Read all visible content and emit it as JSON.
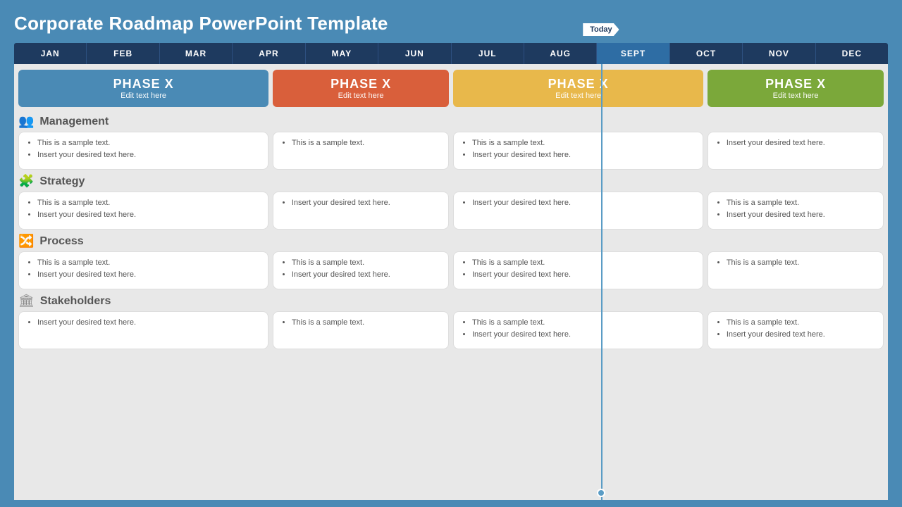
{
  "title": "Corporate Roadmap PowerPoint Template",
  "today_label": "Today",
  "months": [
    "JAN",
    "FEB",
    "MAR",
    "APR",
    "MAY",
    "JUN",
    "JUL",
    "AUG",
    "SEPT",
    "OCT",
    "NOV",
    "DEC"
  ],
  "today_month_index": 8,
  "phases": [
    {
      "label": "PHASE X",
      "subtitle": "Edit text here",
      "color": "blue"
    },
    {
      "label": "PHASE X",
      "subtitle": "Edit text here",
      "color": "orange"
    },
    {
      "label": "PHASE X",
      "subtitle": "Edit text here",
      "color": "yellow"
    },
    {
      "label": "PHASE X",
      "subtitle": "Edit text here",
      "color": "green"
    }
  ],
  "sections": [
    {
      "title": "Management",
      "icon": "👥",
      "cards": [
        {
          "items": [
            "This is a sample text.",
            "Insert your desired text here."
          ]
        },
        {
          "items": [
            "This is a sample text."
          ]
        },
        {
          "items": [
            "This is a sample text.",
            "Insert your desired text here."
          ]
        },
        {
          "items": [
            "Insert your desired text here."
          ]
        }
      ]
    },
    {
      "title": "Strategy",
      "icon": "🧩",
      "cards": [
        {
          "items": [
            "This is a sample text.",
            "Insert your desired text here."
          ]
        },
        {
          "items": [
            "Insert your desired text here."
          ]
        },
        {
          "items": [
            "Insert your desired text here."
          ]
        },
        {
          "items": [
            "This is a sample text.",
            "Insert your desired text here."
          ]
        }
      ]
    },
    {
      "title": "Process",
      "icon": "🔀",
      "cards": [
        {
          "items": [
            "This is a sample text.",
            "Insert your desired text here."
          ]
        },
        {
          "items": [
            "This is a sample text.",
            "Insert your desired text here."
          ]
        },
        {
          "items": [
            "This is a sample text.",
            "Insert your desired text here."
          ]
        },
        {
          "items": [
            "This is a sample text."
          ]
        }
      ]
    },
    {
      "title": "Stakeholders",
      "icon": "🏛",
      "cards": [
        {
          "items": [
            "Insert your desired text here."
          ]
        },
        {
          "items": [
            "This is a sample text."
          ]
        },
        {
          "items": [
            "This is a sample text.",
            "Insert your desired text here."
          ]
        },
        {
          "items": [
            "This is a sample text.",
            "Insert your desired text here."
          ]
        }
      ]
    }
  ]
}
